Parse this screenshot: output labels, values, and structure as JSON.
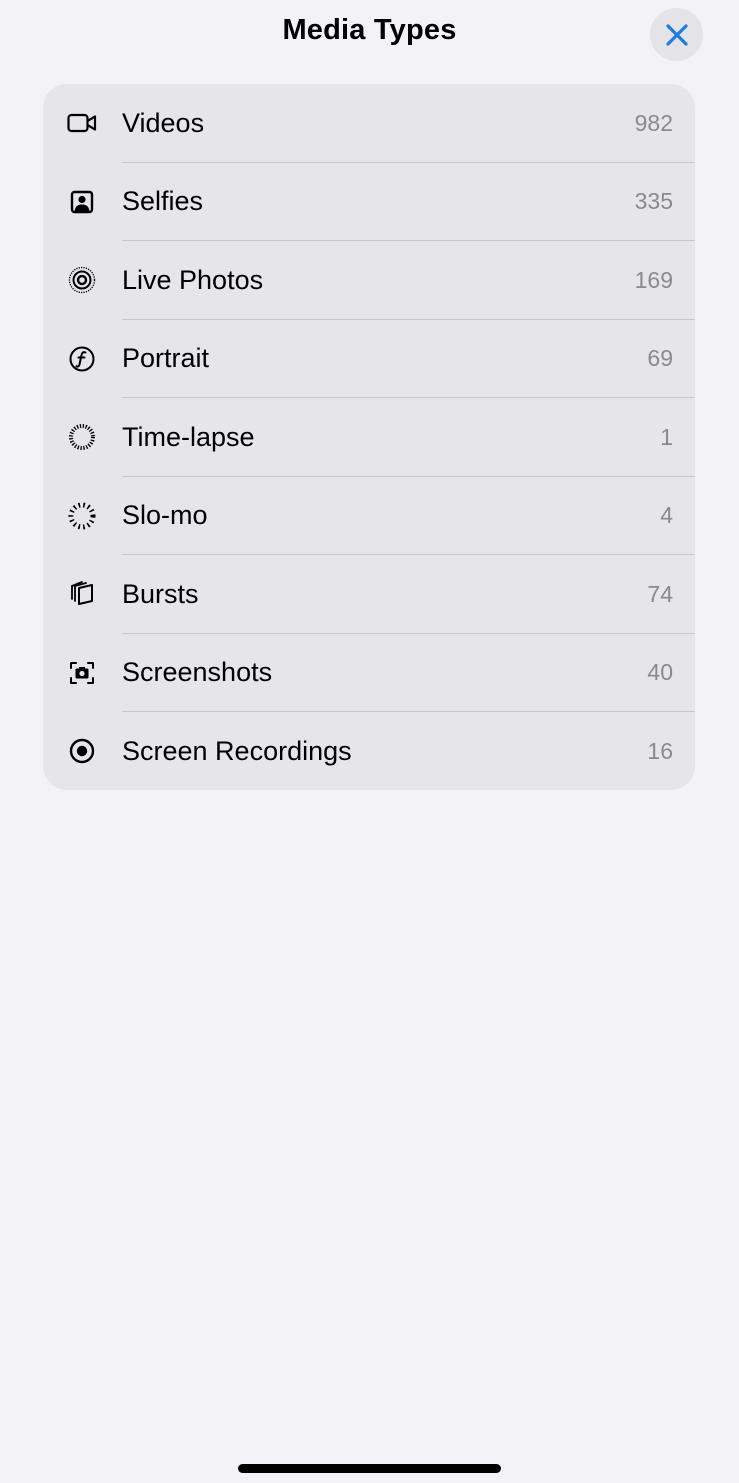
{
  "header": {
    "title": "Media Types",
    "close_icon": "close-icon",
    "accent_color": "#1c7ce0"
  },
  "media_types": [
    {
      "label": "Videos",
      "count": "982",
      "icon": "video-camera-icon"
    },
    {
      "label": "Selfies",
      "count": "335",
      "icon": "person-square-icon"
    },
    {
      "label": "Live Photos",
      "count": "169",
      "icon": "live-photo-icon"
    },
    {
      "label": "Portrait",
      "count": "69",
      "icon": "aperture-f-icon"
    },
    {
      "label": "Time-lapse",
      "count": "1",
      "icon": "timelapse-icon"
    },
    {
      "label": "Slo-mo",
      "count": "4",
      "icon": "slomo-icon"
    },
    {
      "label": "Bursts",
      "count": "74",
      "icon": "burst-stack-icon"
    },
    {
      "label": "Screenshots",
      "count": "40",
      "icon": "screenshot-camera-icon"
    },
    {
      "label": "Screen Recordings",
      "count": "16",
      "icon": "record-circle-icon"
    }
  ]
}
